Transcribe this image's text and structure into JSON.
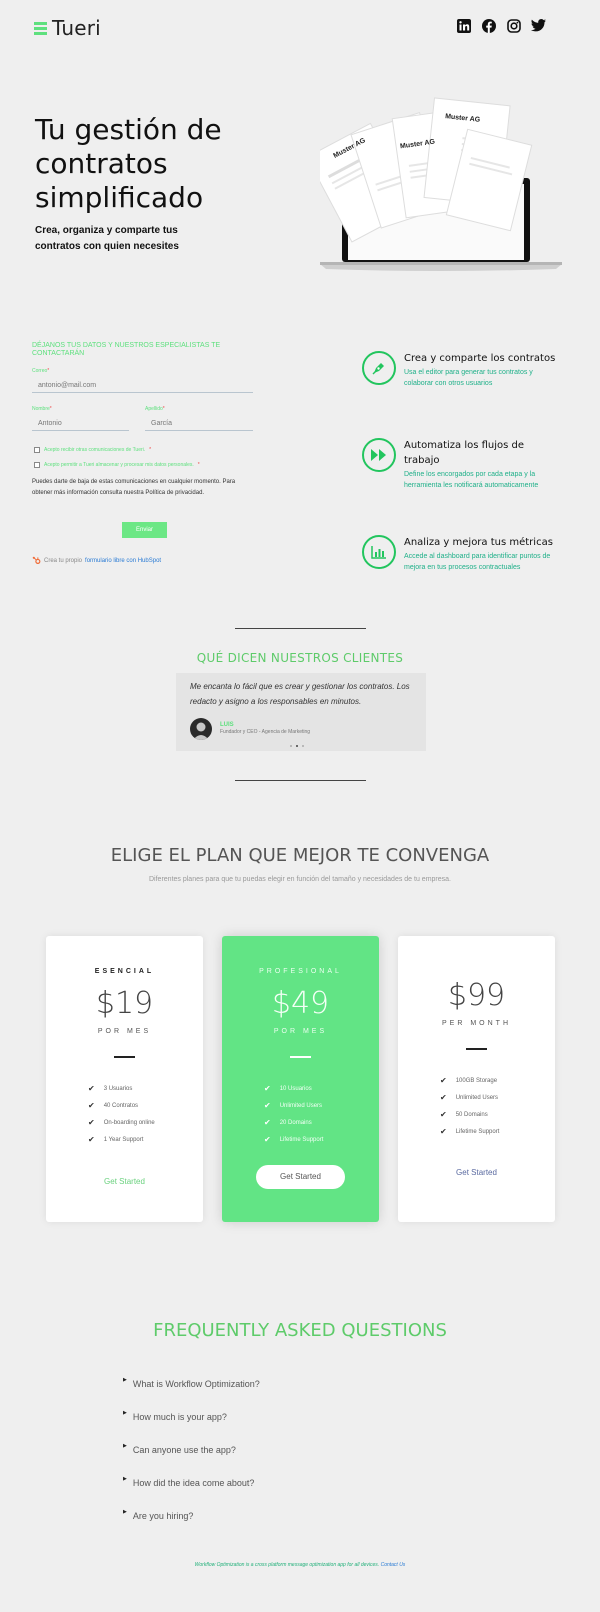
{
  "header": {
    "logo_text": "Tueri",
    "social_icons": [
      "linkedin-icon",
      "facebook-icon",
      "instagram-icon",
      "twitter-icon"
    ]
  },
  "hero": {
    "title": "Tu gestión de contratos simplificado",
    "subtitle": "Crea, organiza y comparte tus contratos con quien necesites",
    "doc_labels": [
      "Muster AG",
      "Muster AG",
      "Muster AG"
    ]
  },
  "form": {
    "heading": "DÉJANOS TUS DATOS Y NUESTROS ESPECIALISTAS TE CONTACTARÁN",
    "email_label": "Correo",
    "email_placeholder": "antonio@mail.com",
    "name_label": "Nombre",
    "name_placeholder": "Antonio",
    "surname_label": "Apellido",
    "surname_placeholder": "García",
    "required_mark": "*",
    "consent_1": "Acepto recibir otras comunicaciones de Tueri.",
    "consent_2": "Acepto permitir a Tueri almacenar y procesar mis datos personales.",
    "legal_text": "Puedes darte de baja de estas comunicaciones en cualquier momento. Para obtener más información consulta nuestra Política de privacidad.",
    "submit_label": "Enviar",
    "hubspot_text": "Crea tu propio",
    "hubspot_link": "formulario libre con HubSpot"
  },
  "features": [
    {
      "icon": "pen-icon",
      "title": "Crea y comparte los contratos",
      "desc": "Usa el editor para generar tus contratos y colaborar con otros usuarios"
    },
    {
      "icon": "fast-forward-icon",
      "title": "Automatiza los flujos de trabajo",
      "desc": "Define los encorgados por cada etapa y la herramienta les notificará automaticamente"
    },
    {
      "icon": "bar-chart-icon",
      "title": "Analiza y mejora tus métricas",
      "desc": "Accede al dashboard para identificar puntos de mejora en tus procesos contractuales"
    }
  ],
  "testimonials": {
    "heading": "QUÉ DICEN NUESTROS CLIENTES",
    "quote": "Me encanta lo fácil que es crear y gestionar los contratos. Los redacto y asigno a los responsables en minutos.",
    "name": "LUIS",
    "role": "Fundador y CEO - Agencia de Marketing"
  },
  "pricing": {
    "heading": "ELIGE EL PLAN QUE MEJOR TE CONVENGA",
    "subheading": "Diferentes planes para que tu puedas elegir en función del tamaño y necesidades de tu empresa.",
    "plans": [
      {
        "name": "ESENCIAL",
        "price": "$19",
        "period": "POR MES",
        "features": [
          "3 Usuarios",
          "40 Contratos",
          "On-boarding online",
          "1 Year Support"
        ],
        "cta": "Get Started"
      },
      {
        "name": "PROFESIONAL",
        "price": "$49",
        "period": "POR MES",
        "features": [
          "10 Usuarios",
          "Unlimited Users",
          "20 Domains",
          "Lifetime Support"
        ],
        "cta": "Get Started"
      },
      {
        "name": "",
        "price": "$99",
        "period": "PER MONTH",
        "features": [
          "100GB Storage",
          "Unlimited Users",
          "50 Domains",
          "Lifetime Support"
        ],
        "cta": "Get Started"
      }
    ]
  },
  "faq": {
    "heading": "FREQUENTLY ASKED QUESTIONS",
    "items": [
      "What is Workflow Optimization?",
      "How much is your app?",
      "Can anyone use the app?",
      "How did the idea come about?",
      "Are you hiring?"
    ]
  },
  "footer": {
    "text": "Workflow Optimization is a cross platform message optimization app for all devices.",
    "link": "Contact Us"
  },
  "colors": {
    "accent": "#5ee07e",
    "teal": "#1fb089",
    "background": "#efefef"
  }
}
